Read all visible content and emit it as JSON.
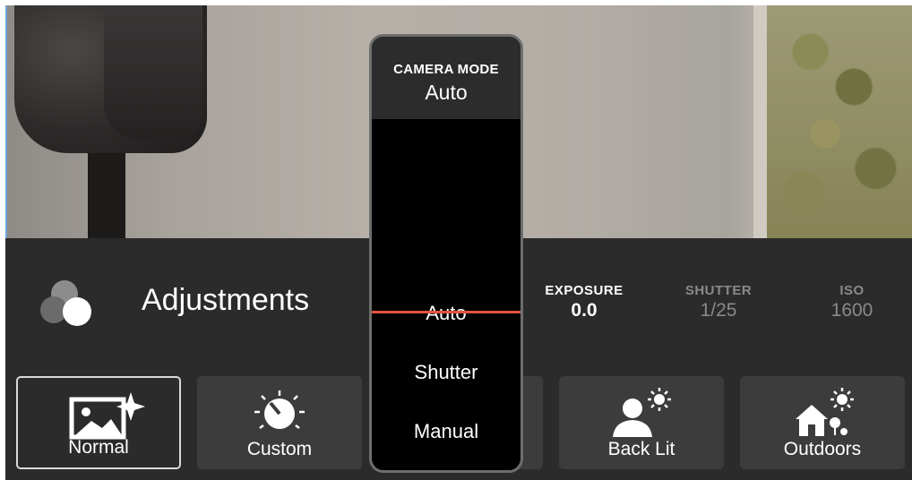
{
  "picker": {
    "caption": "CAMERA MODE",
    "current": "Auto",
    "options": [
      "Auto",
      "Shutter",
      "Manual"
    ]
  },
  "panel": {
    "title": "Adjustments"
  },
  "readouts": {
    "exposure": {
      "label": "EXPOSURE",
      "value": "0.0"
    },
    "shutter": {
      "label": "SHUTTER",
      "value": "1/25"
    },
    "iso": {
      "label": "ISO",
      "value": "1600"
    }
  },
  "modes": [
    {
      "label": "Normal",
      "icon": "image-sparkle-icon",
      "selected": true
    },
    {
      "label": "Custom",
      "icon": "dial-icon",
      "selected": false
    },
    {
      "label": "",
      "icon": "",
      "selected": false
    },
    {
      "label": "Back Lit",
      "icon": "person-sun-icon",
      "selected": false
    },
    {
      "label": "Outdoors",
      "icon": "house-sun-icon",
      "selected": false
    }
  ],
  "colors": {
    "panel_bg": "#2b2b2b",
    "button_bg": "#3c3c3c",
    "picker_line": "#e2533e",
    "dim_text": "#8a8a8a"
  }
}
